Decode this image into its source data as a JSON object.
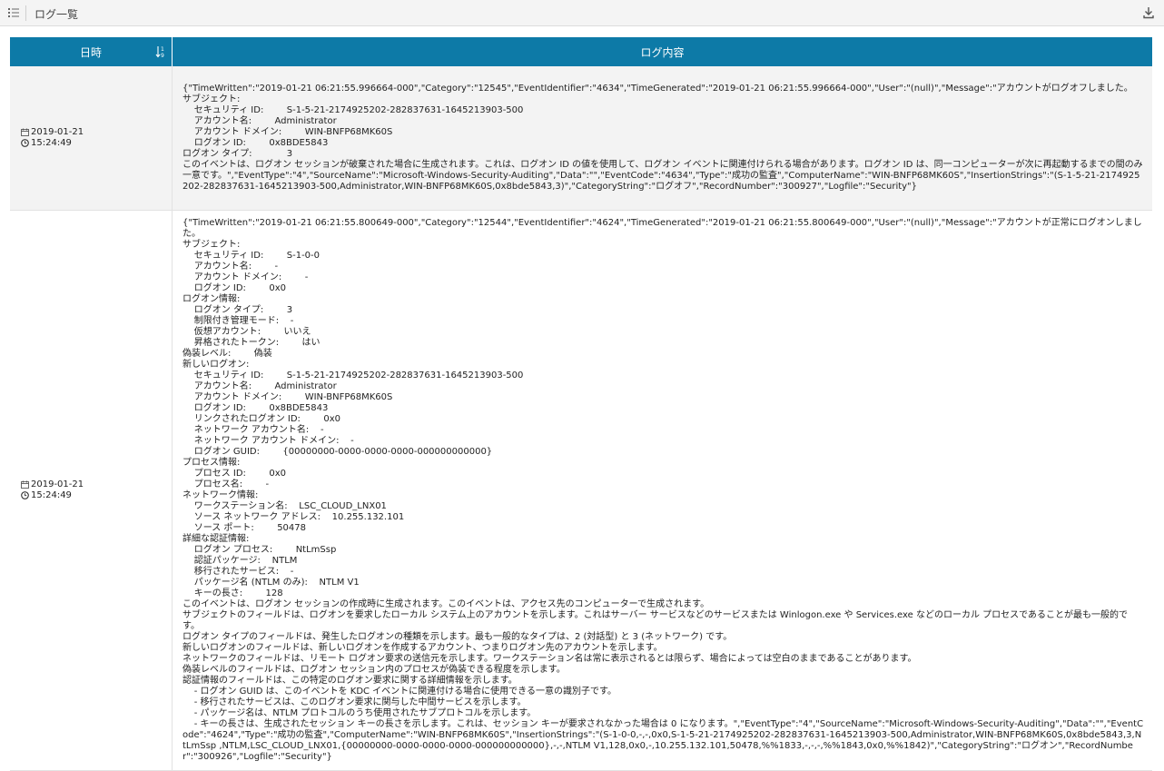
{
  "header": {
    "title": "ログ一覧",
    "menu_icon": "list-menu-icon",
    "download_icon": "download-icon"
  },
  "colors": {
    "header_bg": "#0d7aa7",
    "row_alt_bg": "#f3f3f3"
  },
  "table": {
    "columns": [
      "日時",
      "ログ内容"
    ],
    "rows": [
      {
        "date": "2019-01-21",
        "time": "15:24:49",
        "log": "{\"TimeWritten\":\"2019-01-21 06:21:55.996664-000\",\"Category\":\"12545\",\"EventIdentifier\":\"4634\",\"TimeGenerated\":\"2019-01-21 06:21:55.996664-000\",\"User\":\"(null)\",\"Message\":\"アカウントがログオフしました。\nサブジェクト:\n    セキュリティ ID:        S-1-5-21-2174925202-282837631-1645213903-500\n    アカウント名:        Administrator\n    アカウント ドメイン:        WIN-BNFP68MK60S\n    ログオン ID:        0x8BDE5843\nログオン タイプ:            3\nこのイベントは、ログオン セッションが破棄された場合に生成されます。これは、ログオン ID の値を使用して、ログオン イベントに関連付けられる場合があります。ログオン ID は、同一コンピューターが次に再起動するまでの間のみ一意です。\",\"EventType\":\"4\",\"SourceName\":\"Microsoft-Windows-Security-Auditing\",\"Data\":\"\",\"EventCode\":\"4634\",\"Type\":\"成功の監査\",\"ComputerName\":\"WIN-BNFP68MK60S\",\"InsertionStrings\":\"(S-1-5-21-2174925202-282837631-1645213903-500,Administrator,WIN-BNFP68MK60S,0x8bde5843,3)\",\"CategoryString\":\"ログオフ\",\"RecordNumber\":\"300927\",\"Logfile\":\"Security\"}"
      },
      {
        "date": "2019-01-21",
        "time": "15:24:49",
        "log": "{\"TimeWritten\":\"2019-01-21 06:21:55.800649-000\",\"Category\":\"12544\",\"EventIdentifier\":\"4624\",\"TimeGenerated\":\"2019-01-21 06:21:55.800649-000\",\"User\":\"(null)\",\"Message\":\"アカウントが正常にログオンしました。\nサブジェクト:\n    セキュリティ ID:        S-1-0-0\n    アカウント名:        -\n    アカウント ドメイン:        -\n    ログオン ID:        0x0\nログオン情報:\n    ログオン タイプ:        3\n    制限付き管理モード:    -\n    仮想アカウント:        いいえ\n    昇格されたトークン:        はい\n偽装レベル:        偽装\n新しいログオン:\n    セキュリティ ID:        S-1-5-21-2174925202-282837631-1645213903-500\n    アカウント名:        Administrator\n    アカウント ドメイン:        WIN-BNFP68MK60S\n    ログオン ID:        0x8BDE5843\n    リンクされたログオン ID:        0x0\n    ネットワーク アカウント名:    -\n    ネットワーク アカウント ドメイン:    -\n    ログオン GUID:        {00000000-0000-0000-0000-000000000000}\nプロセス情報:\n    プロセス ID:        0x0\n    プロセス名:        -\nネットワーク情報:\n    ワークステーション名:    LSC_CLOUD_LNX01\n    ソース ネットワーク アドレス:    10.255.132.101\n    ソース ポート:        50478\n詳細な認証情報:\n    ログオン プロセス:        NtLmSsp\n    認証パッケージ:    NTLM\n    移行されたサービス:    -\n    パッケージ名 (NTLM のみ):    NTLM V1\n    キーの長さ:        128\nこのイベントは、ログオン セッションの作成時に生成されます。このイベントは、アクセス先のコンピューターで生成されます。\nサブジェクトのフィールドは、ログオンを要求したローカル システム上のアカウントを示します。これはサーバー サービスなどのサービスまたは Winlogon.exe や Services.exe などのローカル プロセスであることが最も一般的です。\nログオン タイプのフィールドは、発生したログオンの種類を示します。最も一般的なタイプは、2 (対話型) と 3 (ネットワーク) です。\n新しいログオンのフィールドは、新しいログオンを作成するアカウント、つまりログオン先のアカウントを示します。\nネットワークのフィールドは、リモート ログオン要求の送信元を示します。ワークステーション名は常に表示されるとは限らず、場合によっては空白のままであることがあります。\n偽装レベルのフィールドは、ログオン セッション内のプロセスが偽装できる程度を示します。\n認証情報のフィールドは、この特定のログオン要求に関する詳細情報を示します。\n    - ログオン GUID は、このイベントを KDC イベントに関連付ける場合に使用できる一意の識別子です。\n    - 移行されたサービスは、このログオン要求に関与した中間サービスを示します。\n    - パッケージ名は、NTLM プロトコルのうち使用されたサブプロトコルを示します。\n    - キーの長さは、生成されたセッション キーの長さを示します。これは、セッション キーが要求されなかった場合は 0 になります。\",\"EventType\":\"4\",\"SourceName\":\"Microsoft-Windows-Security-Auditing\",\"Data\":\"\",\"EventCode\":\"4624\",\"Type\":\"成功の監査\",\"ComputerName\":\"WIN-BNFP68MK60S\",\"InsertionStrings\":\"(S-1-0-0,-,-,0x0,S-1-5-21-2174925202-282837631-1645213903-500,Administrator,WIN-BNFP68MK60S,0x8bde5843,3,NtLmSsp ,NTLM,LSC_CLOUD_LNX01,{00000000-0000-0000-0000-000000000000},-,-,NTLM V1,128,0x0,-,10.255.132.101,50478,%%1833,-,-,-,%%1843,0x0,%%1842)\",\"CategoryString\":\"ログオン\",\"RecordNumber\":\"300926\",\"Logfile\":\"Security\"}"
      }
    ]
  }
}
